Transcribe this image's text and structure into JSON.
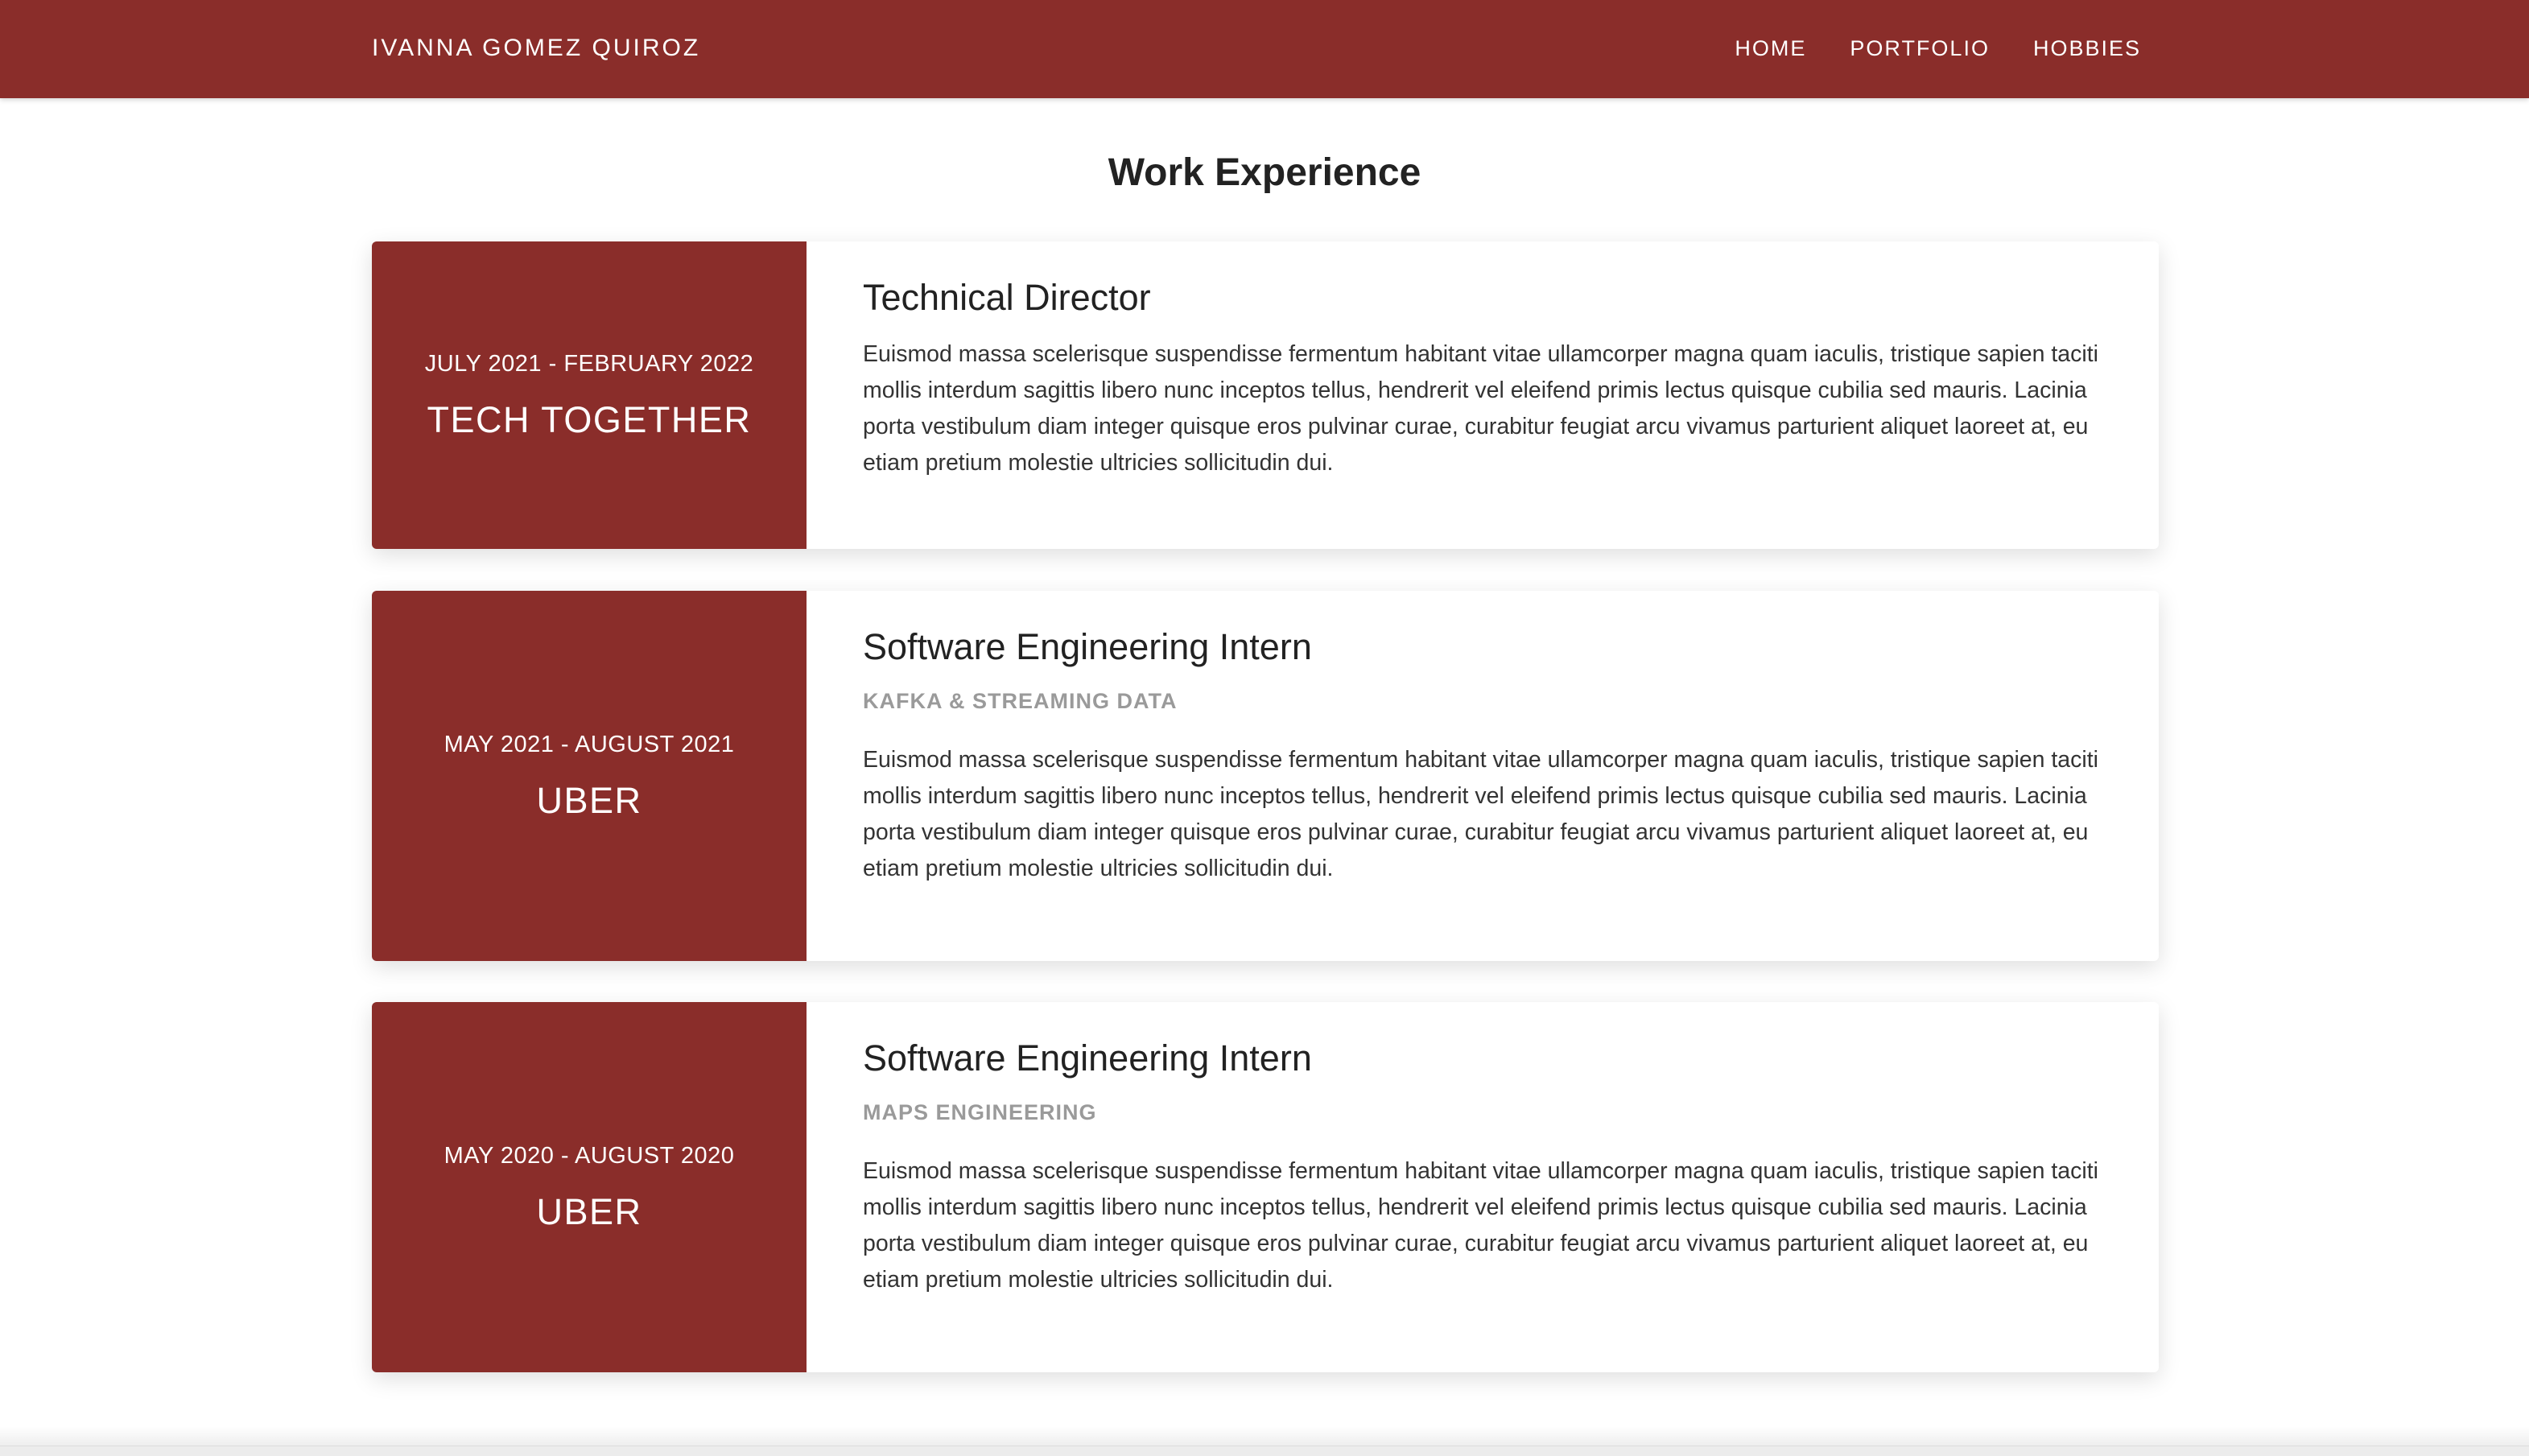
{
  "nav": {
    "brand": "IVANNA GOMEZ QUIROZ",
    "links": [
      "HOME",
      "PORTFOLIO",
      "HOBBIES"
    ]
  },
  "colors": {
    "accent": "#8a2d2a",
    "subtitle": "#9a9a9a",
    "text": "#222222"
  },
  "main": {
    "title": "Work Experience",
    "experiences": [
      {
        "dates": "JULY 2021 - FEBRUARY 2022",
        "company": "TECH TOGETHER",
        "role": "Technical Director",
        "subtitle": "",
        "description": "Euismod massa scelerisque suspendisse fermentum habitant vitae ullamcorper magna quam iaculis, tristique sapien taciti mollis interdum sagittis libero nunc inceptos tellus, hendrerit vel eleifend primis lectus quisque cubilia sed mauris. Lacinia porta vestibulum diam integer quisque eros pulvinar curae, curabitur feugiat arcu vivamus parturient aliquet laoreet at, eu etiam pretium molestie ultricies sollicitudin dui."
      },
      {
        "dates": "MAY 2021 - AUGUST 2021",
        "company": "UBER",
        "role": "Software Engineering Intern",
        "subtitle": "KAFKA & STREAMING DATA",
        "description": "Euismod massa scelerisque suspendisse fermentum habitant vitae ullamcorper magna quam iaculis, tristique sapien taciti mollis interdum sagittis libero nunc inceptos tellus, hendrerit vel eleifend primis lectus quisque cubilia sed mauris. Lacinia porta vestibulum diam integer quisque eros pulvinar curae, curabitur feugiat arcu vivamus parturient aliquet laoreet at, eu etiam pretium molestie ultricies sollicitudin dui."
      },
      {
        "dates": "MAY 2020 - AUGUST 2020",
        "company": "UBER",
        "role": "Software Engineering Intern",
        "subtitle": "MAPS ENGINEERING",
        "description": "Euismod massa scelerisque suspendisse fermentum habitant vitae ullamcorper magna quam iaculis, tristique sapien taciti mollis interdum sagittis libero nunc inceptos tellus, hendrerit vel eleifend primis lectus quisque cubilia sed mauris. Lacinia porta vestibulum diam integer quisque eros pulvinar curae, curabitur feugiat arcu vivamus parturient aliquet laoreet at, eu etiam pretium molestie ultricies sollicitudin dui."
      }
    ]
  }
}
